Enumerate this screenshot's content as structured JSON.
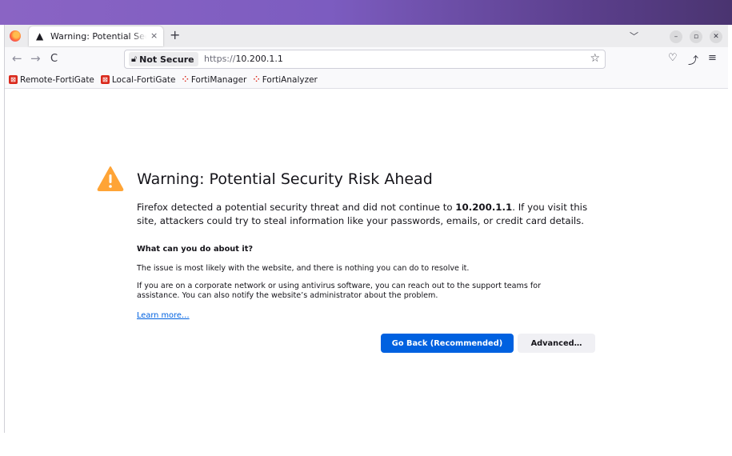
{
  "browser": {
    "tab": {
      "title": "Warning: Potential Security Risk Ahead",
      "close_glyph": "×",
      "icon": "warning-triangle-icon"
    },
    "new_tab_glyph": "+",
    "tab_list_glyph": "﹀",
    "window_controls": {
      "minimize": "–",
      "maximize": "▫",
      "close": "✕"
    }
  },
  "navbar": {
    "back_glyph": "←",
    "forward_glyph": "→",
    "reload_glyph": "C",
    "not_secure_label": "Not Secure",
    "url_scheme": "https://",
    "url_host": "10.200.1.1",
    "bookmark_star_glyph": "☆",
    "pocket_glyph": "♡",
    "extensions_glyph": "⤴",
    "menu_glyph": "≡"
  },
  "bookmarks": [
    {
      "label": "Remote-FortiGate",
      "icon": "fortigate-icon"
    },
    {
      "label": "Local-FortiGate",
      "icon": "fortigate-icon"
    },
    {
      "label": "FortiManager",
      "icon": "fortinet-icon"
    },
    {
      "label": "FortiAnalyzer",
      "icon": "fortinet-icon"
    }
  ],
  "page": {
    "title": "Warning: Potential Security Risk Ahead",
    "intro_before": "Firefox detected a potential security threat and did not continue to ",
    "intro_host": "10.200.1.1",
    "intro_after": ". If you visit this site, attackers could try to steal information like your passwords, emails, or credit card details.",
    "what_heading": "What can you do about it?",
    "issue_text": "The issue is most likely with the website, and there is nothing you can do to resolve it.",
    "corporate_text": "If you are on a corporate network or using antivirus software, you can reach out to the support teams for assistance. You can also notify the website’s administrator about the problem.",
    "learn_more": "Learn more…",
    "go_back_button": "Go Back (Recommended)",
    "advanced_button": "Advanced…"
  },
  "colors": {
    "accent_blue": "#0061e0",
    "warning_orange": "#ffa436",
    "desktop_bar_purple": "#7c5cc0",
    "fortinet_red": "#da291c"
  }
}
